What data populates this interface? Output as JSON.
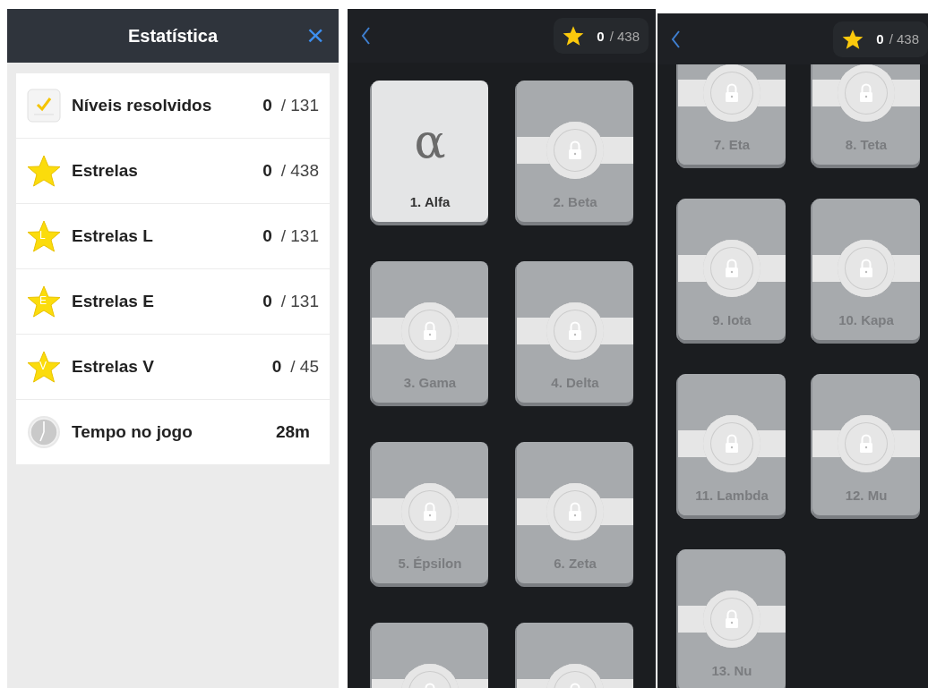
{
  "stats_screen": {
    "title": "Estatística",
    "close": "×",
    "rows": [
      {
        "kind": "check",
        "label": "Níveis resolvidos",
        "value": "0",
        "total": "/ 131"
      },
      {
        "kind": "star",
        "label": "Estrelas",
        "value": "0",
        "total": "/ 438"
      },
      {
        "kind": "star",
        "badge": "L",
        "label": "Estrelas L",
        "value": "0",
        "total": "/ 131"
      },
      {
        "kind": "star",
        "badge": "E",
        "label": "Estrelas E",
        "value": "0",
        "total": "/ 131"
      },
      {
        "kind": "star",
        "badge": "V",
        "label": "Estrelas V",
        "value": "0",
        "total": "/ 45"
      },
      {
        "kind": "clock",
        "label": "Tempo no jogo",
        "value": "28m"
      }
    ]
  },
  "level_screens": [
    {
      "kind": "top",
      "stars_value": "0",
      "stars_total": "/ 438",
      "levels": [
        {
          "label": "1. Alfa",
          "locked": false,
          "symbol": "α"
        },
        {
          "label": "2. Beta",
          "locked": true
        },
        {
          "label": "3. Gama",
          "locked": true
        },
        {
          "label": "4. Delta",
          "locked": true
        },
        {
          "label": "5. Épsilon",
          "locked": true
        },
        {
          "label": "6. Zeta",
          "locked": true
        },
        {
          "locked": true
        },
        {
          "locked": true
        }
      ]
    },
    {
      "kind": "scrolled",
      "stars_value": "0",
      "stars_total": "/ 438",
      "levels": [
        {
          "label": "7. Eta",
          "locked": true
        },
        {
          "label": "8. Teta",
          "locked": true
        },
        {
          "label": "9. Iota",
          "locked": true
        },
        {
          "label": "10. Kapa",
          "locked": true
        },
        {
          "label": "11. Lambda",
          "locked": true
        },
        {
          "label": "12. Mu",
          "locked": true
        },
        {
          "label": "13. Nu",
          "locked": true
        }
      ]
    }
  ]
}
